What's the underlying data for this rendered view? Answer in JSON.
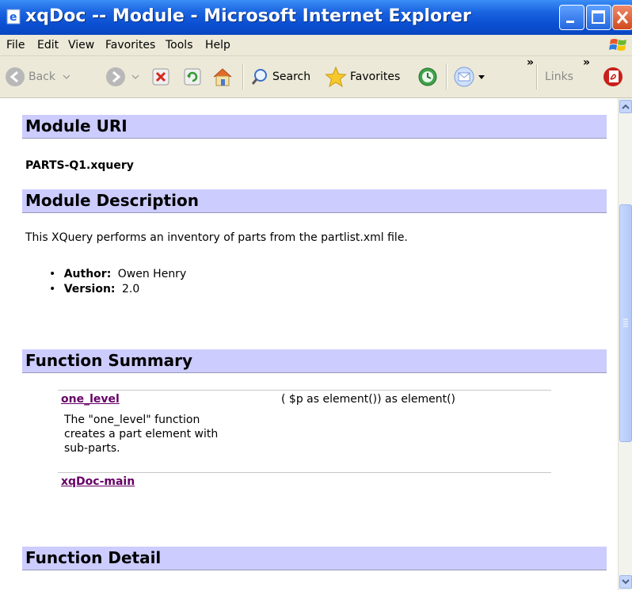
{
  "window": {
    "title": "xqDoc -- Module - Microsoft Internet Explorer"
  },
  "menu": [
    "File",
    "Edit",
    "View",
    "Favorites",
    "Tools",
    "Help"
  ],
  "toolbar": {
    "back_label": "Back",
    "search_label": "Search",
    "favorites_label": "Favorites",
    "links_label": "Links",
    "chevron": "»"
  },
  "page": {
    "module_uri_heading": "Module URI",
    "module_uri_value": "PARTS-Q1.xquery",
    "module_description_heading": "Module Description",
    "module_description_text": "This XQuery performs an inventory of parts from the partlist.xml file.",
    "author_label": "Author:",
    "author_value": "Owen Henry",
    "version_label": "Version:",
    "version_value": "2.0",
    "function_summary_heading": "Function Summary",
    "functions": [
      {
        "name": "one_level",
        "signature": "( $p as element()) as element()",
        "description_lines": [
          "The \"one_level\" function",
          "creates a part element with",
          "sub-parts."
        ]
      },
      {
        "name": "xqDoc-main",
        "signature": "",
        "description_lines": []
      }
    ],
    "function_detail_heading": "Function Detail"
  },
  "colors": {
    "heading_bar": "#ccccff",
    "link": "#660066",
    "titlebar": "#0a4fd1",
    "chrome": "#ece9d8"
  }
}
